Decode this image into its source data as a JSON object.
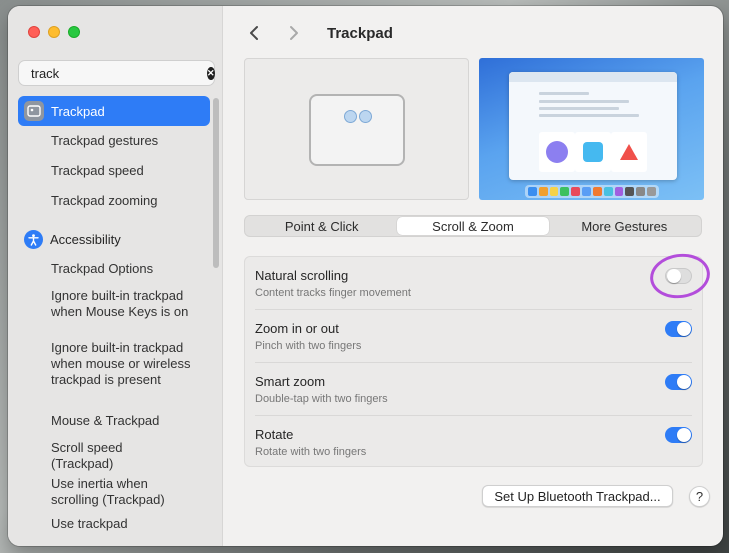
{
  "search": {
    "value": "track",
    "icon": "magnifying-glass-icon",
    "clear_icon": "clear-x-icon"
  },
  "sidebar": {
    "items": [
      {
        "label": "Trackpad",
        "selected": true,
        "icon": "trackpad-icon"
      },
      {
        "label": "Trackpad gestures"
      },
      {
        "label": "Trackpad speed"
      },
      {
        "label": "Trackpad zooming"
      },
      {
        "label": "Accessibility",
        "icon": "accessibility-icon"
      },
      {
        "label": "Trackpad Options"
      },
      {
        "label": "Ignore built-in trackpad when Mouse Keys is on"
      },
      {
        "label": "Ignore built-in trackpad when mouse or wireless trackpad is present"
      },
      {
        "label": "Mouse & Trackpad"
      },
      {
        "label": "Scroll speed (Trackpad)"
      },
      {
        "label": "Use inertia when scrolling (Trackpad)"
      },
      {
        "label": "Use trackpad"
      }
    ]
  },
  "header": {
    "title": "Trackpad",
    "back_icon": "chevron-left-icon",
    "forward_icon": "chevron-right-icon"
  },
  "tabs": [
    {
      "label": "Point & Click",
      "active": false
    },
    {
      "label": "Scroll & Zoom",
      "active": true
    },
    {
      "label": "More Gestures",
      "active": false
    }
  ],
  "settings": [
    {
      "title": "Natural scrolling",
      "subtitle": "Content tracks finger movement",
      "enabled": false
    },
    {
      "title": "Zoom in or out",
      "subtitle": "Pinch with two fingers",
      "enabled": true
    },
    {
      "title": "Smart zoom",
      "subtitle": "Double-tap with two fingers",
      "enabled": true
    },
    {
      "title": "Rotate",
      "subtitle": "Rotate with two fingers",
      "enabled": true
    }
  ],
  "footer": {
    "bluetooth_button": "Set Up Bluetooth Trackpad...",
    "help": "?"
  },
  "colors": {
    "accent": "#2e7cf6",
    "annotation": "#b34ddb"
  }
}
